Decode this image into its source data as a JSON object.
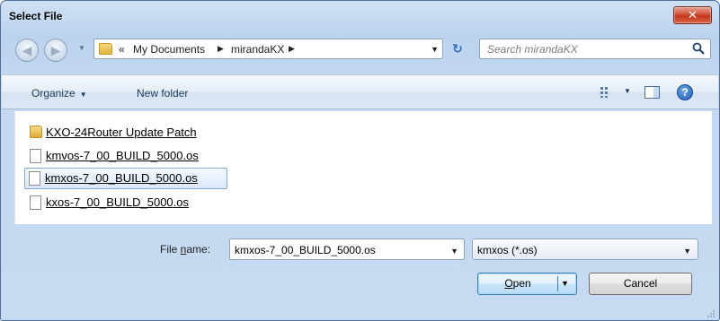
{
  "window": {
    "title": "Select File",
    "close_glyph": "✕"
  },
  "nav": {
    "back_icon": "back-arrow-icon",
    "forward_icon": "forward-arrow-icon",
    "breadcrumb_prefix": "«",
    "breadcrumbs": [
      "My Documents",
      "mirandaKX"
    ],
    "search_placeholder": "Search mirandaKX"
  },
  "toolbar": {
    "organize_label": "Organize",
    "new_folder_label": "New folder"
  },
  "files": [
    {
      "name": "KXO-24Router Update Patch",
      "type": "folder",
      "selected": false
    },
    {
      "name": "kmvos-7_00_BUILD_5000.os",
      "type": "file",
      "selected": false
    },
    {
      "name": "kmxos-7_00_BUILD_5000.os",
      "type": "file",
      "selected": true
    },
    {
      "name": "kxos-7_00_BUILD_5000.os",
      "type": "file",
      "selected": false
    }
  ],
  "bottom": {
    "file_name_label_pre": "File ",
    "file_name_label_accel": "n",
    "file_name_label_post": "ame:",
    "file_name_value": "kmxos-7_00_BUILD_5000.os",
    "filter_value": "kmxos (*.os)",
    "open_accel": "O",
    "open_rest": "pen",
    "cancel_label": "Cancel"
  },
  "colors": {
    "accent": "#2d6bbf",
    "close_button": "#c43518",
    "selection_border": "#84acdd"
  }
}
